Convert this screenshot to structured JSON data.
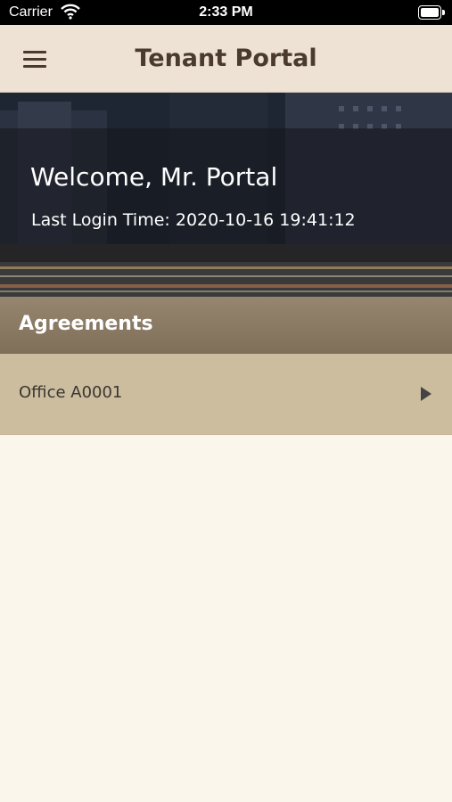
{
  "status_bar": {
    "carrier": "Carrier",
    "time": "2:33 PM"
  },
  "nav": {
    "title": "Tenant Portal",
    "menu_icon": "hamburger-menu-icon"
  },
  "hero": {
    "welcome": "Welcome, Mr. Portal",
    "last_login": "Last Login Time: 2020-10-16 19:41:12"
  },
  "agreements": {
    "header": "Agreements",
    "items": [
      {
        "label": "Office A0001",
        "icon": "chevron-right-icon"
      }
    ]
  },
  "colors": {
    "nav_bg": "#ede2d3",
    "section_header_bg": "#8a7a64",
    "row_bg": "#ccbd9f",
    "page_bg": "#fbf6ec",
    "title_text": "#4a3a30"
  }
}
